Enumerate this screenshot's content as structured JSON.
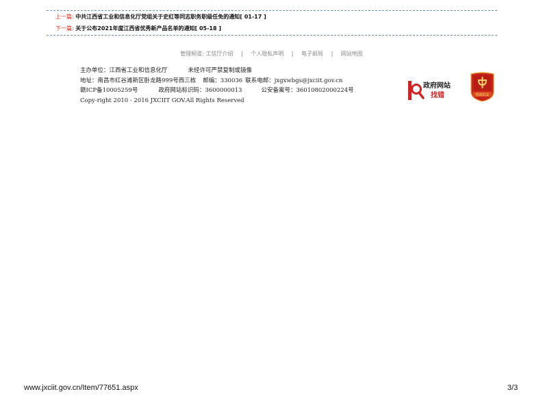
{
  "nav": {
    "prev_label": "上一篇:",
    "prev_title": "中共江西省工业和信息化厅党组关于史红等同志职务职级任免的通知",
    "prev_date": "[ 01-17 ]",
    "next_label": "下一篇:",
    "next_title": "关于公布2021年度江西省优秀新产品名单的通知",
    "next_date": "[ 05-18 ]"
  },
  "footer_links": {
    "prefix": "管理频道:",
    "items": [
      "工信厅介绍",
      "个人隐私声明",
      "电子邮局",
      "网站地图"
    ],
    "separator": "|"
  },
  "info": {
    "sponsor": "主办单位：江西省工业和信息化厅",
    "copy_notice": "未经许可严禁复制或镜像",
    "address": "地址：南昌市红谷滩新区卧龙路999号西三栋",
    "postcode": "邮编：330036",
    "email": "联系电邮：jxgxwbgs@jxciit.gov.cn",
    "icp": "赣ICP备10005259号",
    "site_id": "政府网站标识码：3600000013",
    "police": "公安备案号：36010802000224号",
    "copyright": "Copy-right 2010 - 2016 JXCIIT GOV.All Rights Reserved"
  },
  "badges": {
    "gov_line1": "政府网站",
    "gov_line2": "找错",
    "party_text": "党政机关",
    "gov_red": "#d32020",
    "party_red": "#c8241c"
  },
  "page": {
    "url": "www.jxciit.gov.cn/Item/77651.aspx",
    "number": "3/3"
  }
}
